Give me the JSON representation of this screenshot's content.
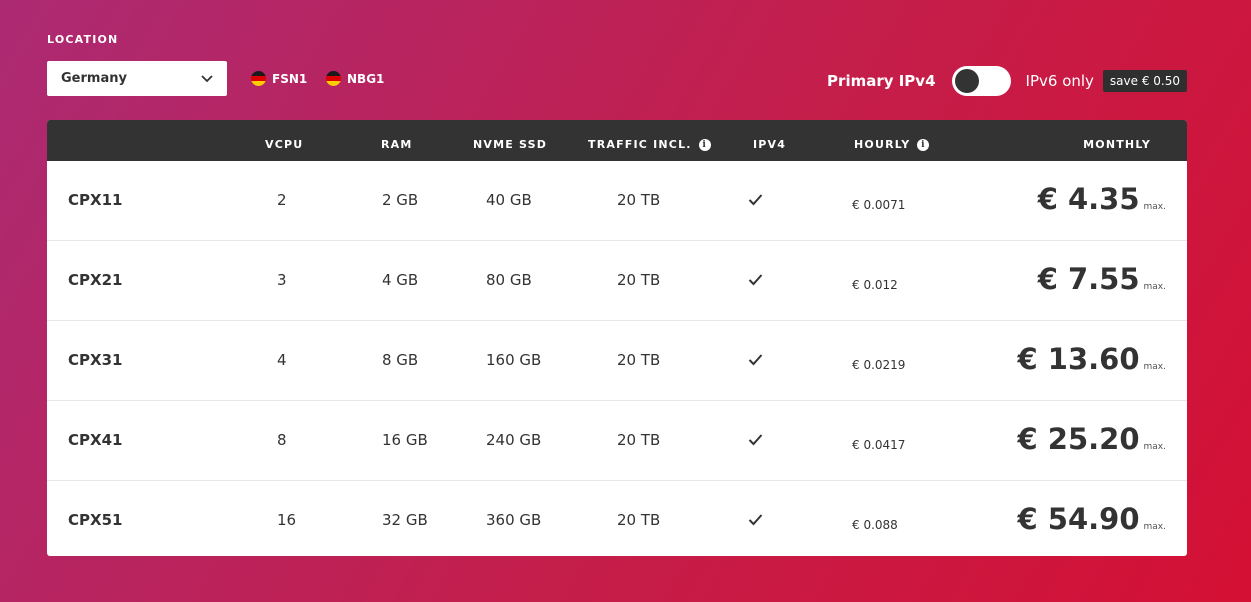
{
  "location": {
    "label": "LOCATION",
    "select_value": "Germany",
    "datacenters": [
      {
        "code": "FSN1",
        "flag": "de-flag"
      },
      {
        "code": "NBG1",
        "flag": "de-flag"
      }
    ]
  },
  "ip": {
    "primary_label": "Primary IPv4",
    "toggle_on": false,
    "ipv6_label": "IPv6 only",
    "save_badge": "save € 0.50"
  },
  "table": {
    "headers": {
      "vcpu": "VCPU",
      "ram": "RAM",
      "ssd": "NVME SSD",
      "traffic": "TRAFFIC INCL.",
      "ipv4": "IPV4",
      "hourly": "HOURLY",
      "monthly": "MONTHLY"
    },
    "max_label": "max.",
    "rows": [
      {
        "name": "CPX11",
        "vcpu": "2",
        "ram": "2 GB",
        "ssd": "40 GB",
        "traffic": "20 TB",
        "ipv4": true,
        "hourly": "€ 0.0071",
        "monthly": "€ 4.35"
      },
      {
        "name": "CPX21",
        "vcpu": "3",
        "ram": "4 GB",
        "ssd": "80 GB",
        "traffic": "20 TB",
        "ipv4": true,
        "hourly": "€ 0.012",
        "monthly": "€ 7.55"
      },
      {
        "name": "CPX31",
        "vcpu": "4",
        "ram": "8 GB",
        "ssd": "160 GB",
        "traffic": "20 TB",
        "ipv4": true,
        "hourly": "€ 0.0219",
        "monthly": "€ 13.60"
      },
      {
        "name": "CPX41",
        "vcpu": "8",
        "ram": "16 GB",
        "ssd": "240 GB",
        "traffic": "20 TB",
        "ipv4": true,
        "hourly": "€ 0.0417",
        "monthly": "€ 25.20"
      },
      {
        "name": "CPX51",
        "vcpu": "16",
        "ram": "32 GB",
        "ssd": "360 GB",
        "traffic": "20 TB",
        "ipv4": true,
        "hourly": "€ 0.088",
        "monthly": "€ 54.90"
      }
    ]
  },
  "colors": {
    "background_start": "#ac2a73",
    "background_end": "#d41034",
    "header_dark": "#333333",
    "text_dark": "#333333"
  }
}
